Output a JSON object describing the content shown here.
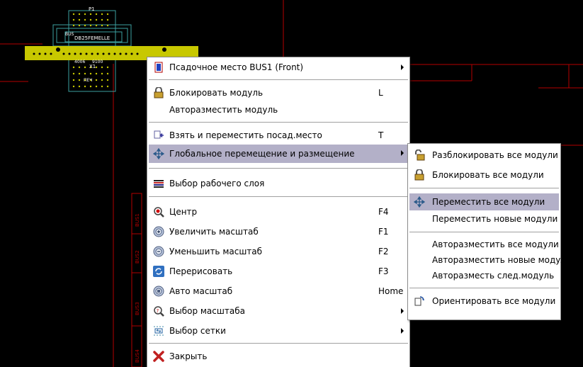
{
  "pcb": {
    "comp_ref": "P1",
    "comp_value": "DB25FEMELLE",
    "bus_label": "BUS",
    "x1_label": "X1",
    "dev_label": "4006",
    "pin_label": "9100",
    "side_labels": [
      "BUS1",
      "BUS2",
      "BUS3",
      "BUS4"
    ]
  },
  "context_menu": {
    "items": [
      {
        "id": "footprint",
        "label": "Псадочное место BUS1 (Front)",
        "key": "",
        "submenu": true,
        "icon": "footprint-icon"
      },
      {
        "id": "lock",
        "label": "Блокировать модуль",
        "key": "L",
        "icon": "lock-icon"
      },
      {
        "id": "autoplace",
        "label": "Авторазместить модуль",
        "key": ""
      },
      {
        "id": "take",
        "label": "Взять и переместить посад.место",
        "key": "T",
        "icon": "move-footprint-icon"
      },
      {
        "id": "global",
        "label": "Глобальное перемещение и размещение",
        "key": "",
        "submenu": true,
        "icon": "move-arrows-icon",
        "highlighted": true
      },
      {
        "id": "layer",
        "label": "Выбор рабочего слоя",
        "key": "",
        "icon": "layers-icon"
      },
      {
        "id": "center",
        "label": "Центр",
        "key": "F4",
        "icon": "zoom-center-icon"
      },
      {
        "id": "zoomin",
        "label": "Увеличить масштаб",
        "key": "F1",
        "icon": "zoom-in-icon"
      },
      {
        "id": "zoomout",
        "label": "Уменьшить масштаб",
        "key": "F2",
        "icon": "zoom-out-icon"
      },
      {
        "id": "redraw",
        "label": "Перерисовать",
        "key": "F3",
        "icon": "redraw-icon"
      },
      {
        "id": "autozoom",
        "label": "Авто масштаб",
        "key": "Home",
        "icon": "zoom-auto-icon"
      },
      {
        "id": "zoomselect",
        "label": "Выбор масштаба",
        "key": "",
        "submenu": true,
        "icon": "zoom-select-icon"
      },
      {
        "id": "gridselect",
        "label": "Выбор сетки",
        "key": "",
        "submenu": true,
        "icon": "grid-icon"
      },
      {
        "id": "close",
        "label": "Закрыть",
        "key": "",
        "icon": "close-icon"
      }
    ]
  },
  "submenu": {
    "items": [
      {
        "id": "unlock_all",
        "label": "Разблокировать все модули",
        "icon": "unlock-icon"
      },
      {
        "id": "lock_all",
        "label": "Блокировать все модули",
        "icon": "lock-icon"
      },
      {
        "id": "move_all",
        "label": "Переместить все модули",
        "icon": "move-arrows-icon",
        "highlighted": true
      },
      {
        "id": "move_new",
        "label": "Переместить новые модули"
      },
      {
        "id": "autoplace_all",
        "label": "Авторазместить все модули"
      },
      {
        "id": "autoplace_new",
        "label": "Авторазместить новые модули"
      },
      {
        "id": "autoplace_next",
        "label": "Авторазместь след.модуль"
      },
      {
        "id": "orient_all",
        "label": "Ориентировать все модули",
        "icon": "orient-icon"
      }
    ]
  },
  "colors": {
    "background": "#000000",
    "highlight": "#b3b0c8",
    "pcb_red": "#b40000",
    "pad_yellow": "#c8c800",
    "silk_cyan": "#3ca0a0",
    "pad_white": "#ffffff"
  }
}
